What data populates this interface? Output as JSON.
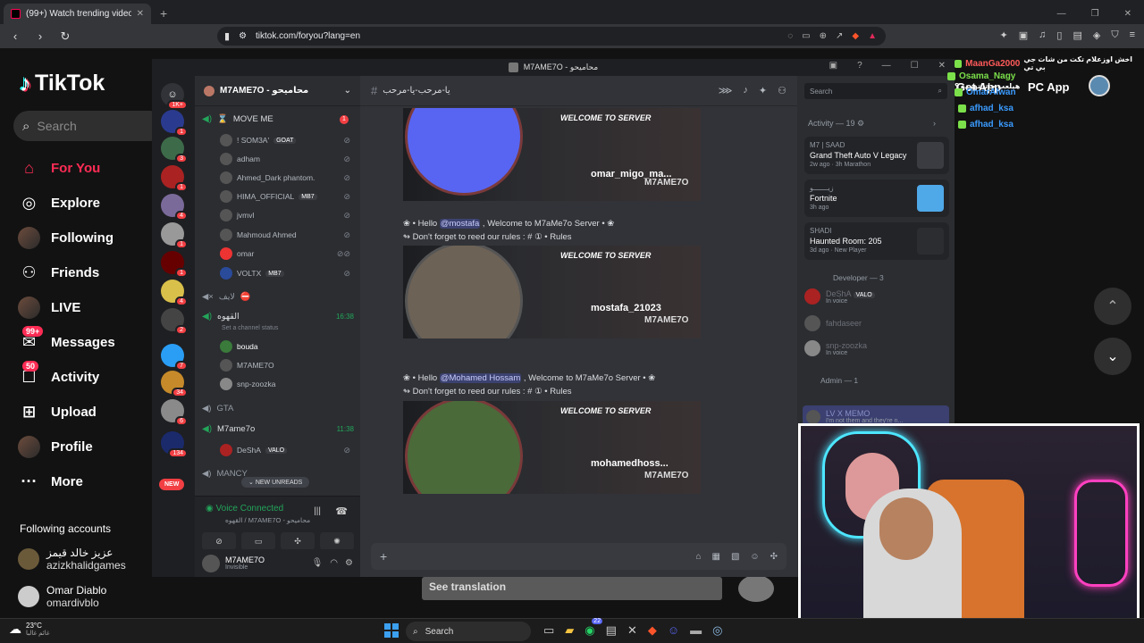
{
  "browser": {
    "tab_title": "(99+) Watch trending videos for",
    "url": "tiktok.com/foryou?lang=en"
  },
  "tiktok": {
    "brand": "TikTok",
    "search_placeholder": "Search",
    "nav": [
      {
        "label": "For You",
        "icon": "home-icon",
        "badge": ""
      },
      {
        "label": "Explore",
        "icon": "compass-icon",
        "badge": ""
      },
      {
        "label": "Following",
        "icon": "avatar-icon",
        "badge": ""
      },
      {
        "label": "Friends",
        "icon": "friends-icon",
        "badge": ""
      },
      {
        "label": "LIVE",
        "icon": "avatar-icon",
        "badge": ""
      },
      {
        "label": "Messages",
        "icon": "message-icon",
        "badge": "99+"
      },
      {
        "label": "Activity",
        "icon": "inbox-icon",
        "badge": "50"
      },
      {
        "label": "Upload",
        "icon": "plus-icon",
        "badge": ""
      },
      {
        "label": "Profile",
        "icon": "avatar-icon",
        "badge": ""
      },
      {
        "label": "More",
        "icon": "more-icon",
        "badge": ""
      }
    ],
    "following_header": "Following accounts",
    "following": [
      {
        "name": "عزيز خالد قيمز",
        "user": "azizkhalidgames"
      },
      {
        "name": "Omar Diablo",
        "user": "omardivblo"
      }
    ],
    "get_app": "Get App",
    "pc_app": "PC App",
    "see_translation": "See translation"
  },
  "discord": {
    "window_title": "M7AME7O - محاميحو",
    "server_name": "M7AME7O - محاميحو",
    "channels": {
      "move_me": "MOVE ME",
      "move_me_users": [
        {
          "name": "! SOM3A'",
          "tag": "GOAT"
        },
        {
          "name": "adham",
          "tag": ""
        },
        {
          "name": "Ahmed_Dark phantom.",
          "tag": ""
        },
        {
          "name": "HIMA_OFFICIAL",
          "tag": "MB7"
        },
        {
          "name": "jvmvl",
          "tag": ""
        },
        {
          "name": "Mahmoud Ahmed",
          "tag": ""
        },
        {
          "name": "omar",
          "tag": ""
        },
        {
          "name": "VOLTX",
          "tag": "MB7"
        }
      ],
      "live": "لايف",
      "qahwa": "القهوه",
      "qahwa_time": "16:38",
      "qahwa_status": "Set a channel status",
      "qahwa_users": [
        "bouda",
        "M7AME7O",
        "snp-zoozka"
      ],
      "gta": "GTA",
      "m7ame7o": "M7ame7o",
      "m7ame7o_time": "11:38",
      "m7ame7o_users": [
        {
          "name": "DeShA",
          "tag": "VALO"
        }
      ],
      "mancy": "MANCY",
      "new_unreads": "NEW UNREADS",
      "move_me_unread": "1"
    },
    "voice": {
      "status": "Voice Connected",
      "channel": "القهوه / M7AME7O - محاميحو"
    },
    "me": {
      "name": "M7AME7O",
      "status": "Invisible"
    },
    "chat": {
      "channel_name": "يا-مرحب-يا-مرحب",
      "search": "Search",
      "welcome_header": "WELCOME TO SERVER",
      "signature": "M7AME7O",
      "messages": [
        {
          "user": "omar_migo_ma...",
          "mention": "",
          "line2": ""
        },
        {
          "user": "mostafa_21023",
          "mention": "@mostafa",
          "line1_pre": "❀ • Hello ",
          "line1_post": " , Welcome to M7aMe7o Server • ❀",
          "line2": "↬ Don't forget to reed our rules : # ① • Rules"
        },
        {
          "user": "mohamedhoss...",
          "mention": "@Mohamed Hossam",
          "line1_pre": "❀ • Hello ",
          "line1_post": " , Welcome to M7aMe7o Server • ❀",
          "line2": "↬ Don't forget to reed our rules : # ① • Rules"
        }
      ]
    },
    "members": {
      "search": "Search",
      "activity_label": "Activity — 19",
      "activities": [
        {
          "who": "M7 | SAAD",
          "game": "Grand Theft Auto V Legacy",
          "meta": "2w ago  ·  3h Marathon"
        },
        {
          "who": "زيـــــــو",
          "game": "Fortnite",
          "meta": "3h ago"
        },
        {
          "who": "SHADI",
          "game": "Haunted Room: 205",
          "meta": "3d ago  ·  New Player"
        }
      ],
      "developer_label": "Developer — 3",
      "developers": [
        {
          "name": "DeShA",
          "tag": "VALO",
          "status": "In voice"
        },
        {
          "name": "fahdaseer",
          "tag": "",
          "status": ""
        },
        {
          "name": "snp-zoozka",
          "tag": "",
          "status": "In voice"
        }
      ],
      "admin_label": "Admin — 1",
      "admin": {
        "name": "LV X MEMO",
        "status": "I'm not them and they're n..."
      }
    },
    "server_badges": [
      "1K+",
      "1",
      "3",
      "1",
      "4",
      "1",
      "1",
      "4",
      "2",
      "7",
      "34",
      "6",
      "134"
    ]
  },
  "overlay_chat": [
    {
      "user": "MaanGa2000",
      "msg": "اخش اوزعلام تكت من شات جي بي تي",
      "color": "#ff5a5a"
    },
    {
      "user": "Osama_Nagy",
      "msg": "هيلعب جاتا تهرده ؟",
      "color": "#7be04a"
    },
    {
      "user": "OmarAlwan",
      "msg": "",
      "color": "#3a9bff"
    },
    {
      "user": "afhad_ksa",
      "msg": "",
      "color": "#3a9bff"
    },
    {
      "user": "afhad_ksa",
      "msg": "",
      "color": "#3a9bff"
    }
  ],
  "taskbar": {
    "temp": "23°C",
    "weather": "غائم غالبا",
    "search": "Search",
    "whatsapp_badge": "22"
  }
}
